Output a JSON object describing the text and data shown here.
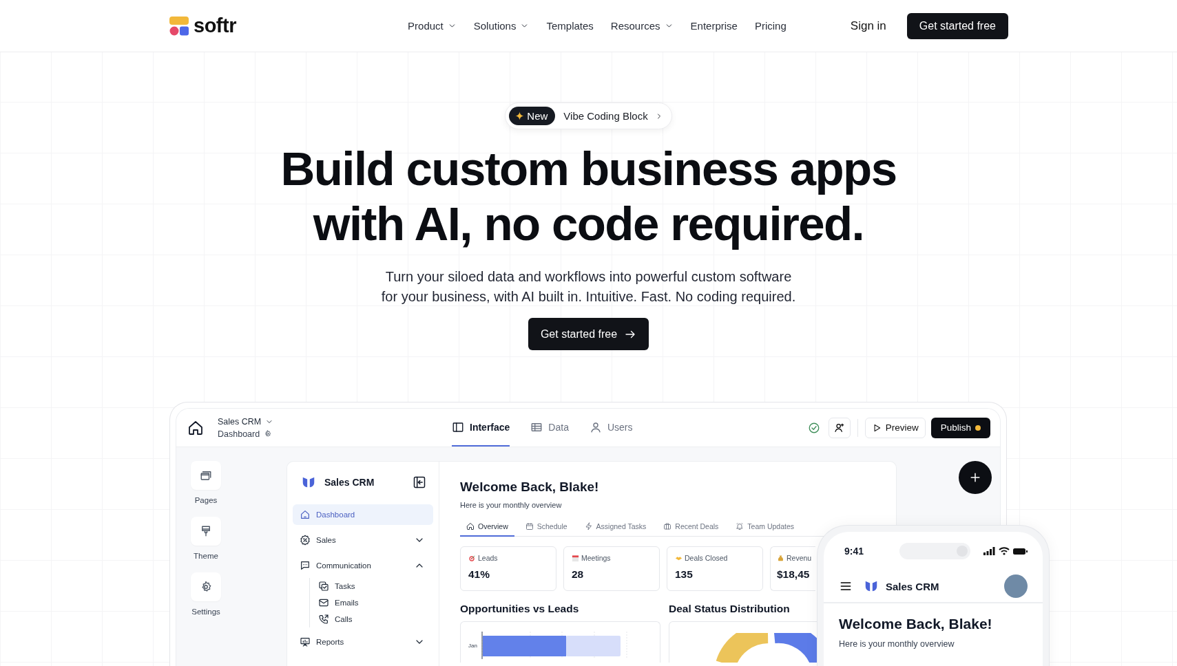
{
  "header": {
    "logo_text": "softr",
    "nav": [
      {
        "label": "Product",
        "dropdown": true
      },
      {
        "label": "Solutions",
        "dropdown": true
      },
      {
        "label": "Templates",
        "dropdown": false
      },
      {
        "label": "Resources",
        "dropdown": true
      },
      {
        "label": "Enterprise",
        "dropdown": false
      },
      {
        "label": "Pricing",
        "dropdown": false
      }
    ],
    "sign_in": "Sign in",
    "cta": "Get started free"
  },
  "hero": {
    "badge": {
      "tag": "New",
      "text": "Vibe Coding Block"
    },
    "title_lines": [
      "Build custom business apps",
      "with AI, no code required."
    ],
    "subtitle_lines": [
      "Turn your siloed data and workflows into powerful custom software",
      "for your business, with AI built in. Intuitive. Fast. No coding required."
    ],
    "cta": "Get started free"
  },
  "app": {
    "app_name": "Sales CRM",
    "page_name": "Dashboard",
    "tabs": [
      {
        "label": "Interface",
        "selected": true
      },
      {
        "label": "Data",
        "selected": false
      },
      {
        "label": "Users",
        "selected": false
      }
    ],
    "preview": "Preview",
    "publish": "Publish",
    "rail": [
      {
        "label": "Pages"
      },
      {
        "label": "Theme"
      },
      {
        "label": "Settings"
      }
    ],
    "sidebar": {
      "title": "Sales CRM",
      "items": [
        {
          "label": "Dashboard",
          "selected": true
        },
        {
          "label": "Sales",
          "selected": false,
          "expanded": false
        },
        {
          "label": "Communication",
          "selected": false,
          "expanded": true,
          "children": [
            {
              "label": "Tasks",
              "selected": false
            },
            {
              "label": "Emails",
              "selected": false
            },
            {
              "label": "Calls",
              "selected": false
            }
          ]
        },
        {
          "label": "Reports",
          "selected": false,
          "expanded": false
        }
      ]
    },
    "dashboard": {
      "title": "Welcome Back, Blake!",
      "subtitle": "Here is your monthly overview",
      "tabs": [
        {
          "label": "Overview",
          "selected": true
        },
        {
          "label": "Schedule",
          "selected": false
        },
        {
          "label": "Assigned Tasks",
          "selected": false
        },
        {
          "label": "Recent Deals",
          "selected": false
        },
        {
          "label": "Team Updates",
          "selected": false
        }
      ],
      "stats": [
        {
          "label": "Leads",
          "value": "41%"
        },
        {
          "label": "Meetings",
          "value": "28"
        },
        {
          "label": "Deals Closed",
          "value": "135"
        },
        {
          "label": "Revenu",
          "value": "$18,45"
        }
      ],
      "charts": [
        {
          "title": "Opportunities vs Leads",
          "row_label": "Jan"
        },
        {
          "title": "Deal Status Distribution"
        }
      ]
    }
  },
  "phone": {
    "time": "9:41",
    "app_name": "Sales CRM",
    "title": "Welcome Back, Blake!",
    "subtitle": "Here is your monthly overview"
  }
}
